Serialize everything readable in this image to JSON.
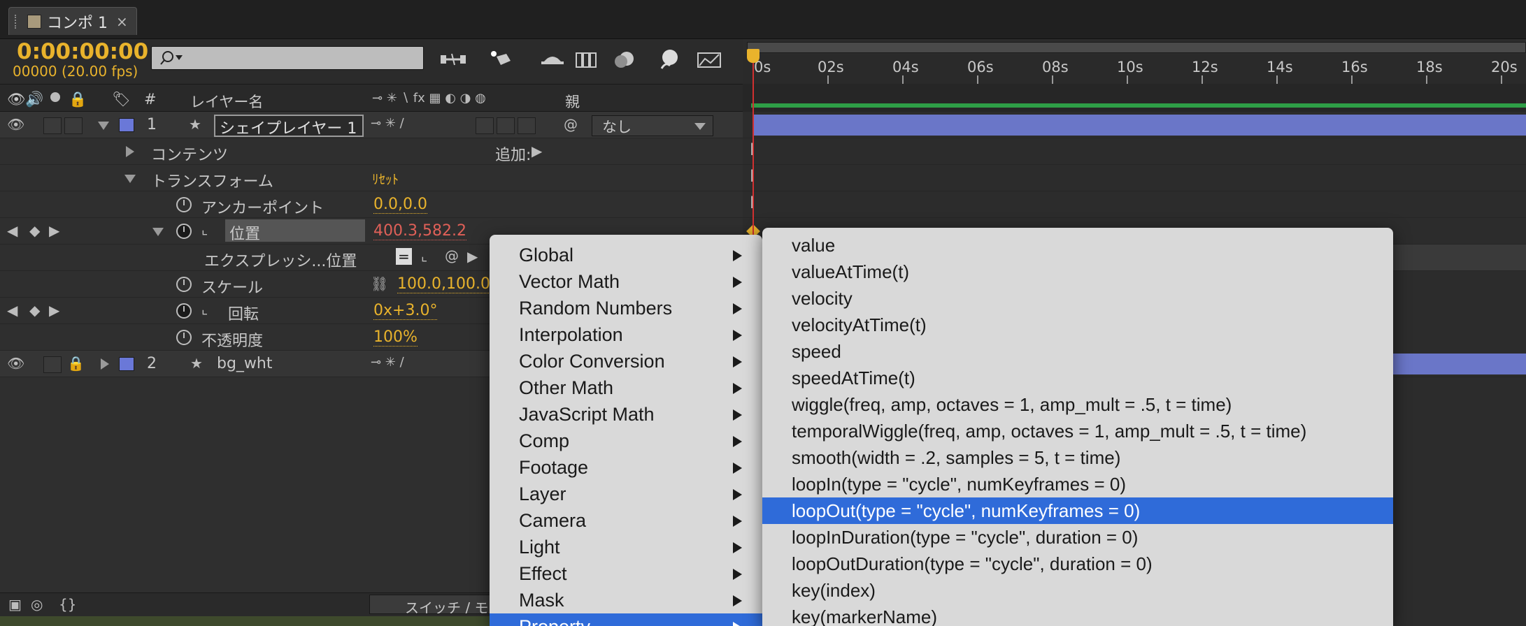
{
  "tab": {
    "title": "コンポ 1",
    "close": "×"
  },
  "header": {
    "timecode": "0:00:00:00",
    "frames": "00000 (20.00 fps)",
    "search_placeholder": ""
  },
  "columns": {
    "hash": "#",
    "layer_name": "レイヤー名",
    "parent": "親"
  },
  "layers": [
    {
      "index": "1",
      "name": "シェイプレイヤー 1",
      "parent": "なし",
      "color": "#6a78d8"
    },
    {
      "index": "2",
      "name": "bg_wht",
      "color": "#6a78d8"
    }
  ],
  "properties": {
    "contents": "コンテンツ",
    "add_label": "追加:",
    "transform": "トランスフォーム",
    "reset": "ﾘｾｯﾄ",
    "anchor_label": "アンカーポイント",
    "anchor_value": "0.0,0.0",
    "position_label": "位置",
    "position_value": "400.3,582.2",
    "expression_label": "エクスプレッシ...位置",
    "scale_label": "スケール",
    "scale_value": "100.0,100.0",
    "rotation_label": "回転",
    "rotation_value": "0x+3.0°",
    "opacity_label": "不透明度",
    "opacity_value": "100%"
  },
  "bottom": {
    "switch_button": "スイッチ / モード"
  },
  "ruler": {
    "ticks": [
      "0s",
      "02s",
      "04s",
      "06s",
      "08s",
      "10s",
      "12s",
      "14s",
      "16s",
      "18s",
      "20s"
    ]
  },
  "menu_categories": [
    {
      "label": "Global"
    },
    {
      "label": "Vector Math"
    },
    {
      "label": "Random Numbers"
    },
    {
      "label": "Interpolation"
    },
    {
      "label": "Color Conversion"
    },
    {
      "label": "Other Math"
    },
    {
      "label": "JavaScript Math"
    },
    {
      "label": "Comp"
    },
    {
      "label": "Footage"
    },
    {
      "label": "Layer"
    },
    {
      "label": "Camera"
    },
    {
      "label": "Light"
    },
    {
      "label": "Effect"
    },
    {
      "label": "Mask"
    },
    {
      "label": "Property"
    }
  ],
  "menu_property_items": [
    {
      "label": "value"
    },
    {
      "label": "valueAtTime(t)"
    },
    {
      "label": "velocity"
    },
    {
      "label": "velocityAtTime(t)"
    },
    {
      "label": "speed"
    },
    {
      "label": "speedAtTime(t)"
    },
    {
      "label": "wiggle(freq, amp, octaves = 1, amp_mult = .5, t = time)"
    },
    {
      "label": "temporalWiggle(freq, amp, octaves = 1, amp_mult = .5, t = time)"
    },
    {
      "label": "smooth(width = .2, samples = 5, t = time)"
    },
    {
      "label": "loopIn(type = \"cycle\", numKeyframes = 0)"
    },
    {
      "label": "loopOut(type = \"cycle\", numKeyframes = 0)"
    },
    {
      "label": "loopInDuration(type = \"cycle\", duration = 0)"
    },
    {
      "label": "loopOutDuration(type = \"cycle\", duration = 0)"
    },
    {
      "label": "key(index)"
    },
    {
      "label": "key(markerName)"
    }
  ],
  "colors": {
    "accent_timecode": "#e9b32c",
    "value_red": "#e06058",
    "menu_highlight": "#2f6bd9",
    "label_swatch": "#6a78d8",
    "playhead": "#d03030"
  }
}
